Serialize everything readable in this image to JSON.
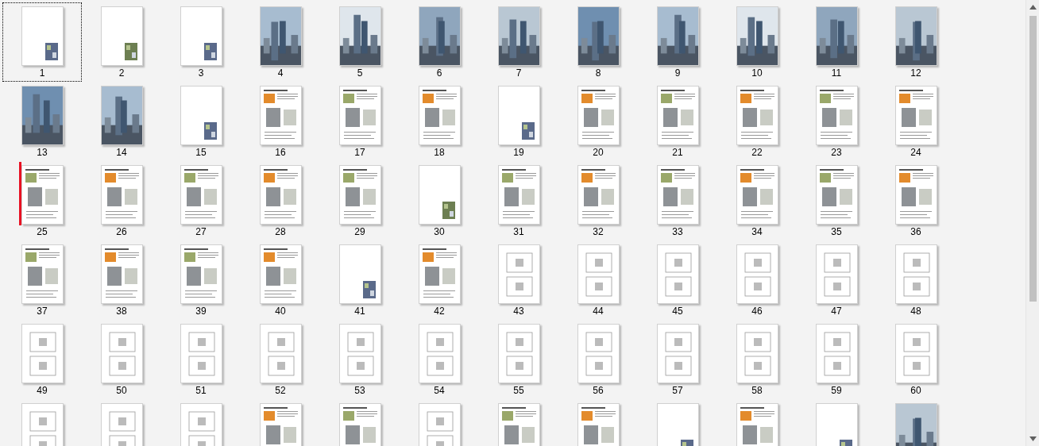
{
  "thumbnails": [
    {
      "label": "1",
      "kind": "sparse",
      "selected": true,
      "insert_marker": false
    },
    {
      "label": "2",
      "kind": "sparse",
      "selected": false,
      "insert_marker": false
    },
    {
      "label": "3",
      "kind": "sparse",
      "selected": false,
      "insert_marker": false
    },
    {
      "label": "4",
      "kind": "render",
      "selected": false,
      "insert_marker": false
    },
    {
      "label": "5",
      "kind": "render",
      "selected": false,
      "insert_marker": false
    },
    {
      "label": "6",
      "kind": "render",
      "selected": false,
      "insert_marker": false
    },
    {
      "label": "7",
      "kind": "render",
      "selected": false,
      "insert_marker": false
    },
    {
      "label": "8",
      "kind": "render",
      "selected": false,
      "insert_marker": false
    },
    {
      "label": "9",
      "kind": "render",
      "selected": false,
      "insert_marker": false
    },
    {
      "label": "10",
      "kind": "render",
      "selected": false,
      "insert_marker": false
    },
    {
      "label": "11",
      "kind": "render",
      "selected": false,
      "insert_marker": false
    },
    {
      "label": "12",
      "kind": "render",
      "selected": false,
      "insert_marker": false
    },
    {
      "label": "13",
      "kind": "render",
      "selected": false,
      "insert_marker": false
    },
    {
      "label": "14",
      "kind": "render",
      "selected": false,
      "insert_marker": false
    },
    {
      "label": "15",
      "kind": "sparse",
      "selected": false,
      "insert_marker": false
    },
    {
      "label": "16",
      "kind": "layout",
      "selected": false,
      "insert_marker": false
    },
    {
      "label": "17",
      "kind": "layout",
      "selected": false,
      "insert_marker": false
    },
    {
      "label": "18",
      "kind": "layout",
      "selected": false,
      "insert_marker": false
    },
    {
      "label": "19",
      "kind": "sparse",
      "selected": false,
      "insert_marker": false
    },
    {
      "label": "20",
      "kind": "layout",
      "selected": false,
      "insert_marker": false
    },
    {
      "label": "21",
      "kind": "layout",
      "selected": false,
      "insert_marker": false
    },
    {
      "label": "22",
      "kind": "layout",
      "selected": false,
      "insert_marker": false
    },
    {
      "label": "23",
      "kind": "layout",
      "selected": false,
      "insert_marker": false
    },
    {
      "label": "24",
      "kind": "layout",
      "selected": false,
      "insert_marker": false
    },
    {
      "label": "25",
      "kind": "layout",
      "selected": false,
      "insert_marker": true
    },
    {
      "label": "26",
      "kind": "layout",
      "selected": false,
      "insert_marker": false
    },
    {
      "label": "27",
      "kind": "layout",
      "selected": false,
      "insert_marker": false
    },
    {
      "label": "28",
      "kind": "layout",
      "selected": false,
      "insert_marker": false
    },
    {
      "label": "29",
      "kind": "layout",
      "selected": false,
      "insert_marker": false
    },
    {
      "label": "30",
      "kind": "sparse",
      "selected": false,
      "insert_marker": false
    },
    {
      "label": "31",
      "kind": "layout",
      "selected": false,
      "insert_marker": false
    },
    {
      "label": "32",
      "kind": "layout",
      "selected": false,
      "insert_marker": false
    },
    {
      "label": "33",
      "kind": "layout",
      "selected": false,
      "insert_marker": false
    },
    {
      "label": "34",
      "kind": "layout",
      "selected": false,
      "insert_marker": false
    },
    {
      "label": "35",
      "kind": "layout",
      "selected": false,
      "insert_marker": false
    },
    {
      "label": "36",
      "kind": "layout",
      "selected": false,
      "insert_marker": false
    },
    {
      "label": "37",
      "kind": "layout",
      "selected": false,
      "insert_marker": false
    },
    {
      "label": "38",
      "kind": "layout",
      "selected": false,
      "insert_marker": false
    },
    {
      "label": "39",
      "kind": "layout",
      "selected": false,
      "insert_marker": false
    },
    {
      "label": "40",
      "kind": "layout",
      "selected": false,
      "insert_marker": false
    },
    {
      "label": "41",
      "kind": "sparse",
      "selected": false,
      "insert_marker": false
    },
    {
      "label": "42",
      "kind": "layout",
      "selected": false,
      "insert_marker": false
    },
    {
      "label": "43",
      "kind": "plan",
      "selected": false,
      "insert_marker": false
    },
    {
      "label": "44",
      "kind": "plan",
      "selected": false,
      "insert_marker": false
    },
    {
      "label": "45",
      "kind": "plan",
      "selected": false,
      "insert_marker": false
    },
    {
      "label": "46",
      "kind": "plan",
      "selected": false,
      "insert_marker": false
    },
    {
      "label": "47",
      "kind": "plan",
      "selected": false,
      "insert_marker": false
    },
    {
      "label": "48",
      "kind": "plan",
      "selected": false,
      "insert_marker": false
    },
    {
      "label": "49",
      "kind": "plan",
      "selected": false,
      "insert_marker": false
    },
    {
      "label": "50",
      "kind": "plan",
      "selected": false,
      "insert_marker": false
    },
    {
      "label": "51",
      "kind": "plan",
      "selected": false,
      "insert_marker": false
    },
    {
      "label": "52",
      "kind": "plan",
      "selected": false,
      "insert_marker": false
    },
    {
      "label": "53",
      "kind": "plan",
      "selected": false,
      "insert_marker": false
    },
    {
      "label": "54",
      "kind": "plan",
      "selected": false,
      "insert_marker": false
    },
    {
      "label": "55",
      "kind": "plan",
      "selected": false,
      "insert_marker": false
    },
    {
      "label": "56",
      "kind": "plan",
      "selected": false,
      "insert_marker": false
    },
    {
      "label": "57",
      "kind": "plan",
      "selected": false,
      "insert_marker": false
    },
    {
      "label": "58",
      "kind": "plan",
      "selected": false,
      "insert_marker": false
    },
    {
      "label": "59",
      "kind": "plan",
      "selected": false,
      "insert_marker": false
    },
    {
      "label": "60",
      "kind": "plan",
      "selected": false,
      "insert_marker": false
    },
    {
      "kind": "plan",
      "selected": false,
      "insert_marker": false
    },
    {
      "kind": "plan",
      "selected": false,
      "insert_marker": false
    },
    {
      "kind": "plan",
      "selected": false,
      "insert_marker": false
    },
    {
      "kind": "layout",
      "selected": false,
      "insert_marker": false
    },
    {
      "kind": "layout",
      "selected": false,
      "insert_marker": false
    },
    {
      "kind": "plan",
      "selected": false,
      "insert_marker": false
    },
    {
      "kind": "layout",
      "selected": false,
      "insert_marker": false
    },
    {
      "kind": "layout",
      "selected": false,
      "insert_marker": false
    },
    {
      "kind": "sparse",
      "selected": false,
      "insert_marker": false
    },
    {
      "kind": "layout",
      "selected": false,
      "insert_marker": false
    },
    {
      "kind": "sparse",
      "selected": false,
      "insert_marker": false
    },
    {
      "kind": "render",
      "selected": false,
      "insert_marker": false
    }
  ]
}
